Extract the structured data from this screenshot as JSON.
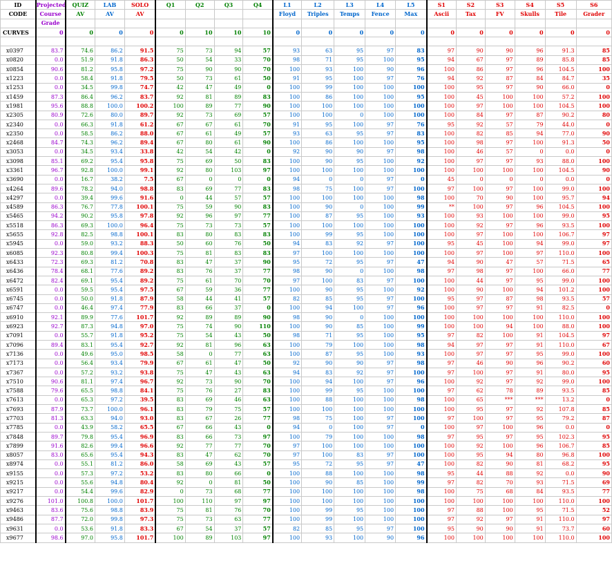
{
  "headers": {
    "row1": [
      "ID",
      "Projected",
      "QUIZ",
      "LAB",
      "SOLO",
      "Q1",
      "Q2",
      "Q3",
      "Q4",
      "L1",
      "L2",
      "L3",
      "L4",
      "L5",
      "S1",
      "S2",
      "S3",
      "S4",
      "S5",
      "S6"
    ],
    "row2": [
      "CODE",
      "Course",
      "AV",
      "AV",
      "AV",
      "",
      "",
      "",
      "",
      "Floyd",
      "Triples",
      "Temps",
      "Fence",
      "Max",
      "Ascii",
      "Tax",
      "FV",
      "Skulls",
      "Tile",
      "Grader"
    ],
    "row3": [
      "",
      "Grade",
      "",
      "",
      "",
      "",
      "",
      "",
      "",
      "",
      "",
      "",
      "",
      "",
      "",
      "",
      "",
      "",
      "",
      ""
    ]
  },
  "curves": [
    "CURVES",
    "0",
    "0",
    "0",
    "0",
    "0",
    "10",
    "10",
    "10",
    "0",
    "0",
    "0",
    "0",
    "0",
    "0",
    "0",
    "0",
    "0",
    "0",
    "0"
  ],
  "rows": [
    [
      "x0397",
      "83.7",
      "74.6",
      "86.2",
      "91.5",
      "75",
      "73",
      "94",
      "57",
      "93",
      "63",
      "95",
      "97",
      "83",
      "97",
      "90",
      "90",
      "96",
      "91.3",
      "85"
    ],
    [
      "x0820",
      "0.0",
      "51.9",
      "91.8",
      "86.3",
      "50",
      "54",
      "33",
      "70",
      "98",
      "71",
      "95",
      "100",
      "95",
      "94",
      "67",
      "97",
      "89",
      "85.8",
      "85"
    ],
    [
      "x0854",
      "90.6",
      "81.2",
      "95.8",
      "97.2",
      "75",
      "90",
      "90",
      "70",
      "100",
      "93",
      "100",
      "90",
      "96",
      "100",
      "86",
      "97",
      "96",
      "104.5",
      "100"
    ],
    [
      "x1223",
      "0.0",
      "58.4",
      "91.8",
      "79.5",
      "50",
      "73",
      "61",
      "50",
      "91",
      "95",
      "100",
      "97",
      "76",
      "94",
      "92",
      "87",
      "84",
      "84.7",
      "35"
    ],
    [
      "x1253",
      "0.0",
      "34.5",
      "99.8",
      "74.7",
      "42",
      "47",
      "49",
      "0",
      "100",
      "99",
      "100",
      "100",
      "100",
      "100",
      "95",
      "97",
      "90",
      "66.0",
      "0"
    ],
    [
      "x1459",
      "87.3",
      "86.4",
      "96.2",
      "83.7",
      "92",
      "81",
      "89",
      "83",
      "100",
      "86",
      "100",
      "100",
      "95",
      "100",
      "45",
      "100",
      "100",
      "57.2",
      "100"
    ],
    [
      "x1981",
      "95.6",
      "88.8",
      "100.0",
      "100.2",
      "100",
      "89",
      "77",
      "90",
      "100",
      "100",
      "100",
      "100",
      "100",
      "100",
      "97",
      "100",
      "100",
      "104.5",
      "100"
    ],
    [
      "x2305",
      "80.9",
      "72.6",
      "80.0",
      "89.7",
      "92",
      "73",
      "69",
      "57",
      "100",
      "100",
      "0",
      "100",
      "100",
      "100",
      "84",
      "97",
      "87",
      "90.2",
      "80"
    ],
    [
      "x2340",
      "0.0",
      "66.3",
      "91.8",
      "61.2",
      "67",
      "67",
      "61",
      "70",
      "91",
      "95",
      "100",
      "97",
      "76",
      "95",
      "92",
      "57",
      "79",
      "44.0",
      "0"
    ],
    [
      "x2350",
      "0.0",
      "58.5",
      "86.2",
      "88.0",
      "67",
      "61",
      "49",
      "57",
      "93",
      "63",
      "95",
      "97",
      "83",
      "100",
      "82",
      "85",
      "94",
      "77.0",
      "90"
    ],
    [
      "x2468",
      "84.7",
      "74.3",
      "96.2",
      "89.4",
      "67",
      "80",
      "61",
      "90",
      "100",
      "86",
      "100",
      "100",
      "95",
      "100",
      "98",
      "97",
      "100",
      "91.3",
      "50"
    ],
    [
      "x3053",
      "0.0",
      "34.5",
      "93.4",
      "33.8",
      "42",
      "54",
      "42",
      "0",
      "92",
      "90",
      "90",
      "97",
      "98",
      "100",
      "46",
      "57",
      "0",
      "0.0",
      "0"
    ],
    [
      "x3098",
      "85.1",
      "69.2",
      "95.4",
      "95.8",
      "75",
      "69",
      "50",
      "83",
      "100",
      "90",
      "95",
      "100",
      "92",
      "100",
      "97",
      "97",
      "93",
      "88.0",
      "100"
    ],
    [
      "x3361",
      "96.7",
      "92.8",
      "100.0",
      "99.1",
      "92",
      "80",
      "103",
      "97",
      "100",
      "100",
      "100",
      "100",
      "100",
      "100",
      "100",
      "100",
      "100",
      "104.5",
      "90"
    ],
    [
      "x3690",
      "0.0",
      "16.7",
      "38.2",
      "7.5",
      "67",
      "0",
      "0",
      "0",
      "94",
      "0",
      "0",
      "97",
      "0",
      "45",
      "0",
      "0",
      "0",
      "0.0",
      "0"
    ],
    [
      "x4264",
      "89.6",
      "78.2",
      "94.0",
      "98.8",
      "83",
      "69",
      "77",
      "83",
      "98",
      "75",
      "100",
      "97",
      "100",
      "97",
      "100",
      "97",
      "100",
      "99.0",
      "100"
    ],
    [
      "x4297",
      "0.0",
      "39.4",
      "99.6",
      "91.6",
      "0",
      "44",
      "57",
      "57",
      "100",
      "100",
      "100",
      "100",
      "98",
      "100",
      "70",
      "90",
      "100",
      "95.7",
      "94"
    ],
    [
      "x4589",
      "86.3",
      "76.7",
      "77.8",
      "100.1",
      "75",
      "59",
      "90",
      "83",
      "100",
      "90",
      "0",
      "100",
      "99",
      "**",
      "100",
      "97",
      "96",
      "104.5",
      "100"
    ],
    [
      "x5465",
      "94.2",
      "90.2",
      "95.8",
      "97.8",
      "92",
      "96",
      "97",
      "77",
      "100",
      "87",
      "95",
      "100",
      "93",
      "100",
      "93",
      "100",
      "100",
      "99.0",
      "95"
    ],
    [
      "x5518",
      "86.3",
      "69.3",
      "100.0",
      "96.4",
      "75",
      "73",
      "73",
      "57",
      "100",
      "100",
      "100",
      "100",
      "100",
      "100",
      "92",
      "97",
      "96",
      "93.5",
      "100"
    ],
    [
      "x5655",
      "92.8",
      "82.5",
      "98.8",
      "100.1",
      "83",
      "80",
      "83",
      "83",
      "100",
      "99",
      "95",
      "100",
      "100",
      "100",
      "97",
      "100",
      "100",
      "106.7",
      "97"
    ],
    [
      "x5945",
      "0.0",
      "59.0",
      "93.2",
      "88.3",
      "50",
      "60",
      "76",
      "50",
      "94",
      "83",
      "92",
      "97",
      "100",
      "95",
      "45",
      "100",
      "94",
      "99.0",
      "97"
    ],
    [
      "x6085",
      "92.3",
      "80.8",
      "99.4",
      "100.3",
      "75",
      "81",
      "83",
      "83",
      "97",
      "100",
      "100",
      "100",
      "100",
      "100",
      "97",
      "100",
      "97",
      "110.0",
      "100"
    ],
    [
      "x6433",
      "72.3",
      "69.3",
      "81.2",
      "70.8",
      "83",
      "47",
      "37",
      "90",
      "95",
      "72",
      "95",
      "97",
      "47",
      "94",
      "90",
      "47",
      "57",
      "71.5",
      "65"
    ],
    [
      "x6436",
      "78.4",
      "68.1",
      "77.6",
      "89.2",
      "83",
      "76",
      "37",
      "77",
      "98",
      "90",
      "0",
      "100",
      "98",
      "97",
      "98",
      "97",
      "100",
      "66.0",
      "77"
    ],
    [
      "x6472",
      "82.4",
      "69.1",
      "95.4",
      "89.2",
      "75",
      "61",
      "70",
      "70",
      "97",
      "100",
      "83",
      "97",
      "100",
      "100",
      "44",
      "97",
      "95",
      "99.0",
      "100"
    ],
    [
      "x6591",
      "0.0",
      "59.5",
      "95.4",
      "97.5",
      "67",
      "59",
      "36",
      "77",
      "100",
      "90",
      "95",
      "100",
      "92",
      "100",
      "90",
      "100",
      "94",
      "101.2",
      "100"
    ],
    [
      "x6745",
      "0.0",
      "50.0",
      "91.8",
      "87.9",
      "58",
      "44",
      "41",
      "57",
      "82",
      "85",
      "95",
      "97",
      "100",
      "95",
      "97",
      "87",
      "98",
      "93.5",
      "57"
    ],
    [
      "x6747",
      "0.0",
      "46.4",
      "97.4",
      "77.9",
      "83",
      "66",
      "37",
      "0",
      "100",
      "94",
      "100",
      "97",
      "96",
      "100",
      "97",
      "97",
      "91",
      "82.5",
      "0"
    ],
    [
      "x6910",
      "92.1",
      "89.9",
      "77.6",
      "101.7",
      "92",
      "89",
      "89",
      "90",
      "98",
      "90",
      "0",
      "100",
      "100",
      "100",
      "100",
      "100",
      "100",
      "110.0",
      "100"
    ],
    [
      "x6923",
      "92.7",
      "87.3",
      "94.8",
      "97.0",
      "75",
      "74",
      "90",
      "110",
      "100",
      "90",
      "85",
      "100",
      "99",
      "100",
      "100",
      "94",
      "100",
      "88.0",
      "100"
    ],
    [
      "x7091",
      "0.0",
      "55.7",
      "91.8",
      "95.2",
      "75",
      "54",
      "43",
      "50",
      "98",
      "71",
      "95",
      "100",
      "95",
      "97",
      "82",
      "100",
      "91",
      "104.5",
      "97"
    ],
    [
      "x7096",
      "89.4",
      "83.1",
      "95.4",
      "92.7",
      "92",
      "81",
      "96",
      "63",
      "100",
      "79",
      "100",
      "100",
      "98",
      "94",
      "97",
      "97",
      "91",
      "110.0",
      "67"
    ],
    [
      "x7136",
      "0.0",
      "49.6",
      "95.0",
      "98.5",
      "58",
      "0",
      "77",
      "63",
      "100",
      "87",
      "95",
      "100",
      "93",
      "100",
      "97",
      "97",
      "95",
      "99.0",
      "100"
    ],
    [
      "x7173",
      "0.0",
      "56.4",
      "93.4",
      "79.9",
      "67",
      "61",
      "47",
      "50",
      "92",
      "90",
      "90",
      "97",
      "98",
      "97",
      "46",
      "90",
      "96",
      "90.2",
      "60"
    ],
    [
      "x7367",
      "0.0",
      "57.2",
      "93.2",
      "93.8",
      "75",
      "47",
      "43",
      "63",
      "94",
      "83",
      "92",
      "97",
      "100",
      "97",
      "100",
      "97",
      "91",
      "80.0",
      "95"
    ],
    [
      "x7510",
      "90.6",
      "81.1",
      "97.4",
      "96.7",
      "92",
      "73",
      "90",
      "70",
      "100",
      "94",
      "100",
      "97",
      "96",
      "100",
      "92",
      "97",
      "92",
      "99.0",
      "100"
    ],
    [
      "x7588",
      "79.6",
      "65.5",
      "98.8",
      "84.1",
      "75",
      "76",
      "27",
      "83",
      "100",
      "99",
      "95",
      "100",
      "100",
      "97",
      "62",
      "78",
      "89",
      "93.5",
      "85"
    ],
    [
      "x7613",
      "0.0",
      "65.3",
      "97.2",
      "39.5",
      "83",
      "69",
      "46",
      "63",
      "100",
      "88",
      "100",
      "100",
      "98",
      "100",
      "65",
      "***",
      "***",
      "13.2",
      "0"
    ],
    [
      "x7693",
      "87.9",
      "73.7",
      "100.0",
      "96.1",
      "83",
      "79",
      "75",
      "57",
      "100",
      "100",
      "100",
      "100",
      "100",
      "100",
      "95",
      "97",
      "92",
      "107.8",
      "85"
    ],
    [
      "x7703",
      "81.3",
      "63.3",
      "94.0",
      "93.0",
      "83",
      "67",
      "26",
      "77",
      "98",
      "75",
      "100",
      "97",
      "100",
      "97",
      "100",
      "97",
      "95",
      "79.2",
      "87"
    ],
    [
      "x7785",
      "0.0",
      "43.9",
      "58.2",
      "65.5",
      "67",
      "66",
      "43",
      "0",
      "94",
      "0",
      "100",
      "97",
      "0",
      "100",
      "97",
      "100",
      "96",
      "0.0",
      "0"
    ],
    [
      "x7848",
      "89.7",
      "79.8",
      "95.4",
      "96.9",
      "83",
      "66",
      "73",
      "97",
      "100",
      "79",
      "100",
      "100",
      "98",
      "97",
      "95",
      "97",
      "95",
      "102.3",
      "95"
    ],
    [
      "x7899",
      "91.6",
      "82.6",
      "99.4",
      "96.6",
      "92",
      "77",
      "77",
      "70",
      "97",
      "100",
      "100",
      "100",
      "100",
      "100",
      "92",
      "100",
      "96",
      "106.7",
      "85"
    ],
    [
      "x8057",
      "83.0",
      "65.6",
      "95.4",
      "94.3",
      "83",
      "47",
      "62",
      "70",
      "97",
      "100",
      "83",
      "97",
      "100",
      "100",
      "95",
      "94",
      "80",
      "96.8",
      "100"
    ],
    [
      "x8974",
      "0.0",
      "55.1",
      "81.2",
      "86.0",
      "58",
      "69",
      "43",
      "57",
      "95",
      "72",
      "95",
      "97",
      "47",
      "100",
      "82",
      "90",
      "81",
      "68.2",
      "95"
    ],
    [
      "x9155",
      "0.0",
      "57.3",
      "97.2",
      "53.2",
      "83",
      "80",
      "66",
      "0",
      "100",
      "88",
      "100",
      "100",
      "98",
      "95",
      "44",
      "88",
      "92",
      "0.0",
      "90"
    ],
    [
      "x9215",
      "0.0",
      "55.6",
      "94.8",
      "80.4",
      "92",
      "0",
      "81",
      "50",
      "100",
      "90",
      "85",
      "100",
      "99",
      "97",
      "82",
      "70",
      "93",
      "71.5",
      "69"
    ],
    [
      "x9217",
      "0.0",
      "54.4",
      "99.6",
      "82.9",
      "0",
      "73",
      "68",
      "77",
      "100",
      "100",
      "100",
      "100",
      "98",
      "100",
      "75",
      "68",
      "84",
      "93.5",
      "77"
    ],
    [
      "x9276",
      "101.0",
      "100.8",
      "100.0",
      "101.7",
      "100",
      "110",
      "97",
      "97",
      "100",
      "100",
      "100",
      "100",
      "100",
      "100",
      "100",
      "100",
      "100",
      "110.0",
      "100"
    ],
    [
      "x9463",
      "83.6",
      "75.6",
      "98.8",
      "83.9",
      "75",
      "81",
      "76",
      "70",
      "100",
      "99",
      "95",
      "100",
      "100",
      "97",
      "88",
      "100",
      "95",
      "71.5",
      "52"
    ],
    [
      "x9486",
      "87.7",
      "72.0",
      "99.8",
      "97.3",
      "75",
      "73",
      "63",
      "77",
      "100",
      "99",
      "100",
      "100",
      "100",
      "97",
      "92",
      "97",
      "91",
      "110.0",
      "97"
    ],
    [
      "x9631",
      "0.0",
      "53.6",
      "91.8",
      "83.3",
      "67",
      "54",
      "37",
      "57",
      "82",
      "85",
      "95",
      "97",
      "100",
      "95",
      "90",
      "90",
      "91",
      "73.7",
      "60"
    ],
    [
      "x9677",
      "98.6",
      "97.0",
      "95.8",
      "101.7",
      "100",
      "89",
      "103",
      "97",
      "100",
      "93",
      "100",
      "90",
      "96",
      "100",
      "100",
      "100",
      "100",
      "110.0",
      "100"
    ]
  ],
  "colors": {
    "projected": "#9900cc",
    "quiz": "#008000",
    "lab": "#0066cc",
    "solo": "#e00000"
  }
}
